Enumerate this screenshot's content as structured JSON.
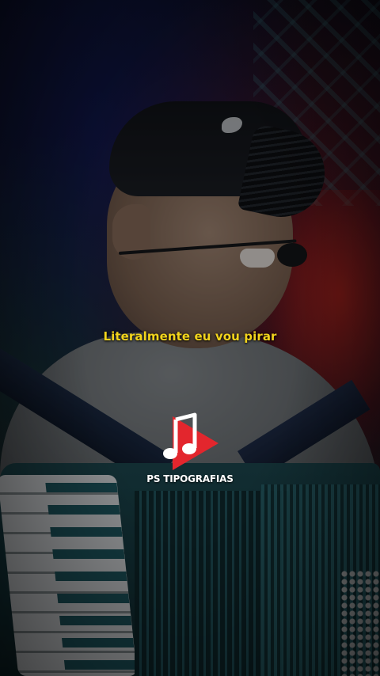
{
  "video": {
    "lyric_line": "Literalmente eu vou pirar",
    "lyric_color": "#f2d41c"
  },
  "watermark": {
    "brand_name": "PS TIPOGRAFIAS",
    "logo_icon": "music-note-play-icon",
    "logo_colors": {
      "play": "#e3262d",
      "note": "#ffffff"
    }
  }
}
